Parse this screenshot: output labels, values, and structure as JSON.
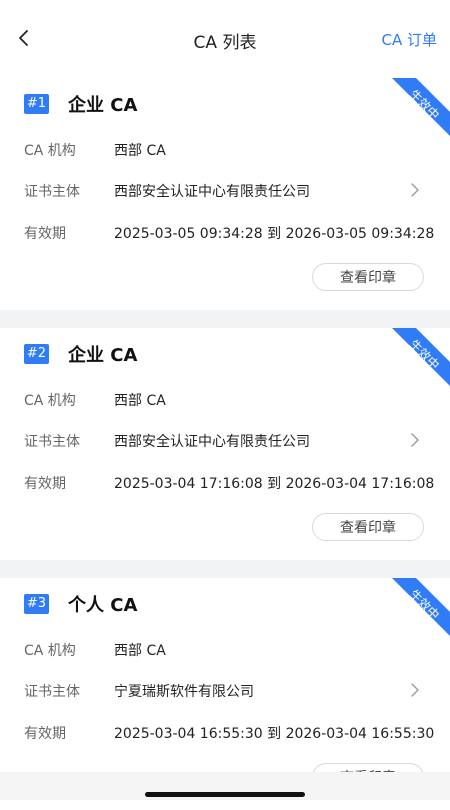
{
  "nav": {
    "title": "CA 列表",
    "orders_label": "CA 订单"
  },
  "cards": [
    {
      "badge": "#1",
      "title": "企业 CA",
      "status": "生效中",
      "org_label": "CA 机构",
      "org_value": "西部 CA",
      "subject_label": "证书主体",
      "subject_value": "西部安全认证中心有限责任公司",
      "validity_label": "有效期",
      "validity_value": "2025-03-05 09:34:28 到 2026-03-05 09:34:28",
      "stamp_label": "查看印章"
    },
    {
      "badge": "#2",
      "title": "企业 CA",
      "status": "生效中",
      "org_label": "CA 机构",
      "org_value": "西部 CA",
      "subject_label": "证书主体",
      "subject_value": "西部安全认证中心有限责任公司",
      "validity_label": "有效期",
      "validity_value": "2025-03-04 17:16:08 到 2026-03-04 17:16:08",
      "stamp_label": "查看印章"
    },
    {
      "badge": "#3",
      "title": "个人 CA",
      "status": "生效中",
      "org_label": "CA 机构",
      "org_value": "西部 CA",
      "subject_label": "证书主体",
      "subject_value": "宁夏瑞斯软件有限公司",
      "validity_label": "有效期",
      "validity_value": "2025-03-04 16:55:30 到 2026-03-04 16:55:30",
      "stamp_label": "查看印章"
    }
  ],
  "colors": {
    "accent": "#2f7cf6",
    "background": "#f2f3f5"
  }
}
